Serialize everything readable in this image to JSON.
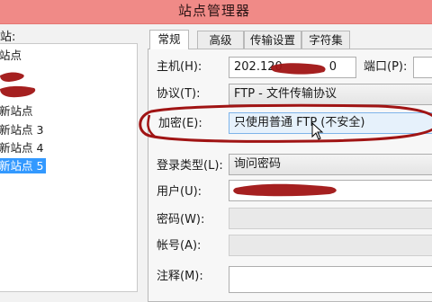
{
  "window": {
    "title": "站点管理器"
  },
  "tree": {
    "header": "站:",
    "items": [
      {
        "label": "站点",
        "selected": false
      },
      {
        "label": "",
        "selected": false
      },
      {
        "label": "",
        "selected": false
      },
      {
        "label": "新站点",
        "selected": false
      },
      {
        "label": "新站点 3",
        "selected": false
      },
      {
        "label": "新站点 4",
        "selected": false
      },
      {
        "label": "新站点 5",
        "selected": true
      }
    ]
  },
  "tabs": [
    {
      "label": "常规",
      "active": true
    },
    {
      "label": "高级",
      "active": false
    },
    {
      "label": "传输设置",
      "active": false
    },
    {
      "label": "字符集",
      "active": false
    }
  ],
  "form": {
    "host_label": "主机(H):",
    "host_value": "202.120",
    "host_value_suffix": "0",
    "port_label": "端口(P):",
    "protocol_label": "协议(T):",
    "protocol_value": "FTP - 文件传输协议",
    "encryption_label": "加密(E):",
    "encryption_value": "只使用普通 FTP (不安全)",
    "logon_type_label": "登录类型(L):",
    "logon_type_value": "询问密码",
    "user_label": "用户(U):",
    "user_value": "",
    "password_label": "密码(W):",
    "account_label": "帐号(A):",
    "comments_label": "注释(M):"
  },
  "colors": {
    "titlebar": "#f08a87",
    "selection": "#3399ff",
    "annotation": "#a01414"
  }
}
